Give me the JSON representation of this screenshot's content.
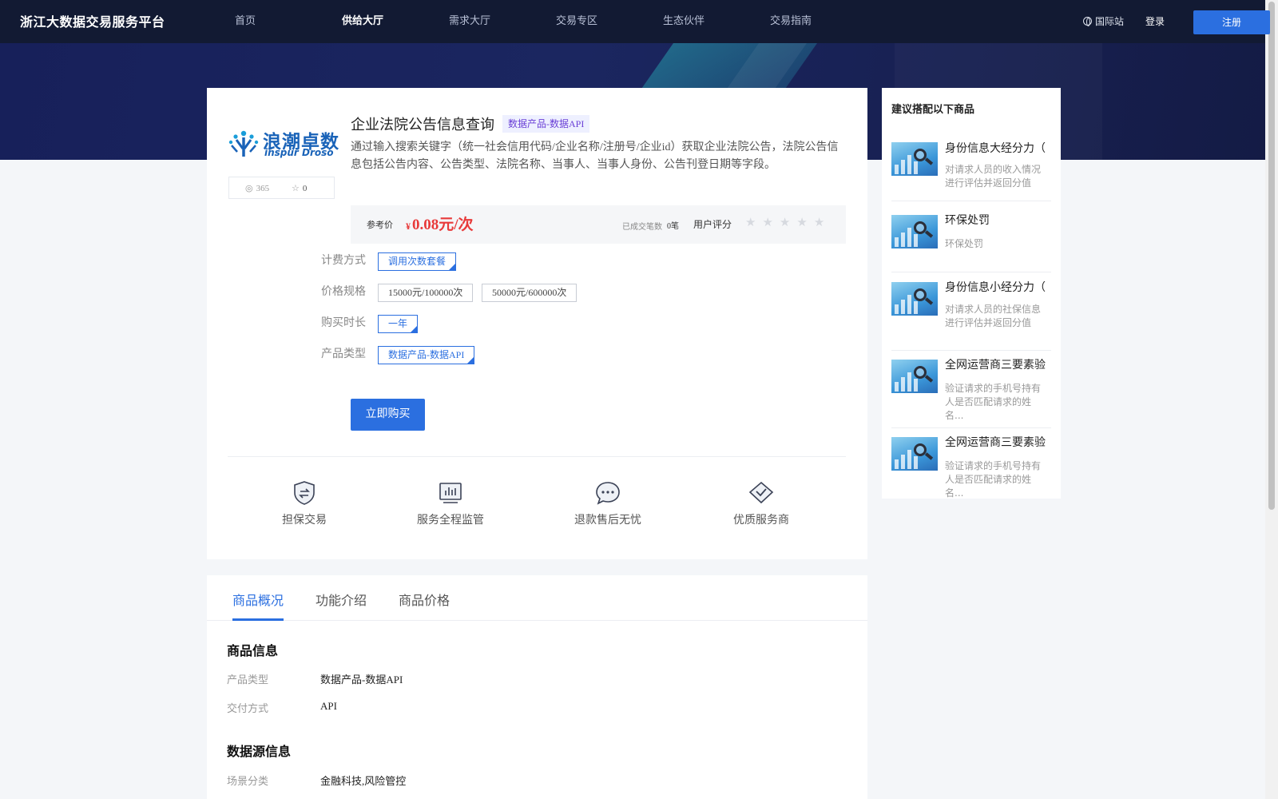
{
  "header": {
    "brand": "浙江大数据交易服务平台",
    "nav": [
      "首页",
      "供给大厅",
      "需求大厅",
      "交易专区",
      "生态伙伴",
      "交易指南"
    ],
    "active_nav": 1,
    "intl": "国际站",
    "login": "登录",
    "register": "注册"
  },
  "product": {
    "logo_cn": "浪潮卓数",
    "logo_en": "inspur Droso",
    "views": "365",
    "favorites": "0",
    "title": "企业法院公告信息查询",
    "tag": "数据产品-数据API",
    "description": "通过输入搜索关键字（统一社会信用代码/企业名称/注册号/企业id）获取企业法院公告，法院公告信息包括公告内容、公告类型、法院名称、当事人、当事人身份、公告刊登日期等字段。",
    "price_label": "参考价",
    "price_currency": "¥",
    "price": "0.08元/次",
    "sold_label": "已成交笔数",
    "sold_value": "0笔",
    "rating_label": "用户评分",
    "rating": 0,
    "rating_max": 5,
    "options": {
      "billing_label": "计费方式",
      "billing": [
        "调用次数套餐"
      ],
      "spec_label": "价格规格",
      "spec": [
        "15000元/100000次",
        "50000元/600000次"
      ],
      "duration_label": "购买时长",
      "duration": [
        "一年"
      ],
      "type_label": "产品类型",
      "type": [
        "数据产品-数据API"
      ]
    },
    "buy_button": "立即购买",
    "features": [
      "担保交易",
      "服务全程监管",
      "退款售后无忧",
      "优质服务商"
    ]
  },
  "sidebar": {
    "title": "建议搭配以下商品",
    "items": [
      {
        "title": "身份信息大经分力（",
        "desc": "对请求人员的收入情况进行评估并返回分值"
      },
      {
        "title": "环保处罚",
        "desc": "环保处罚"
      },
      {
        "title": "身份信息小经分力（",
        "desc": "对请求人员的社保信息进行评估并返回分值"
      },
      {
        "title": "全网运营商三要素验",
        "desc": "验证请求的手机号持有人是否匹配请求的姓名..."
      },
      {
        "title": "全网运营商三要素验",
        "desc": "验证请求的手机号持有人是否匹配请求的姓名..."
      }
    ]
  },
  "tabs": {
    "items": [
      "商品概况",
      "功能介绍",
      "商品价格"
    ],
    "active": 0
  },
  "details": {
    "section1": "商品信息",
    "rows1": [
      {
        "k": "产品类型",
        "v": "数据产品-数据API"
      },
      {
        "k": "交付方式",
        "v": "API"
      }
    ],
    "section2": "数据源信息",
    "rows2": [
      {
        "k": "场景分类",
        "v": "金融科技,风险管控"
      }
    ]
  },
  "colors": {
    "primary": "#2b6fe0",
    "price": "#e83a3a",
    "header_bg": "#121a33"
  }
}
